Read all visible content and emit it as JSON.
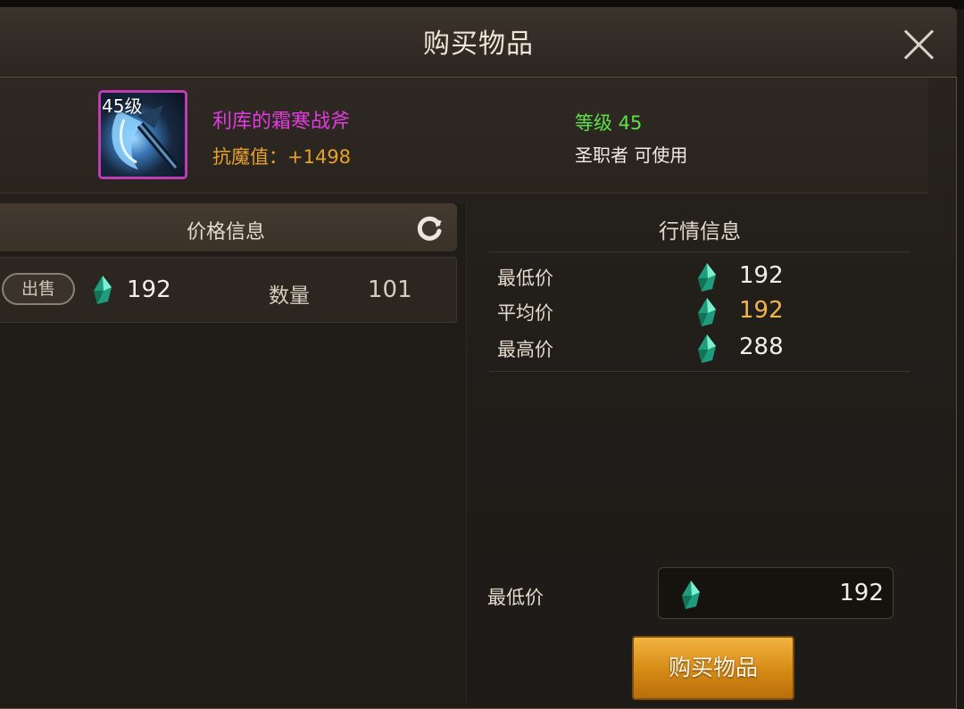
{
  "dialog": {
    "title": "购买物品"
  },
  "item": {
    "level_badge": "45级",
    "name": "利库的霜寒战斧",
    "stat": "抗魔值：+1498",
    "required_level": "等级 45",
    "usable_by": "圣职者 可使用"
  },
  "price_info": {
    "header": "价格信息",
    "listing": {
      "type": "出售",
      "price": "192",
      "quantity_label": "数量",
      "quantity": "101"
    }
  },
  "market_info": {
    "header": "行情信息",
    "rows": [
      {
        "label": "最低价",
        "value": "192"
      },
      {
        "label": "平均价",
        "value": "192"
      },
      {
        "label": "最高价",
        "value": "288"
      }
    ]
  },
  "purchase": {
    "price_label": "最低价",
    "price_value": "192",
    "buy_label": "购买物品"
  },
  "colors": {
    "item_name": "#e23ce0",
    "stat": "#e7a12a",
    "level_ok": "#5fe04a",
    "average_price": "#f0b64c",
    "button": "#e39a22"
  },
  "icons": [
    "close-icon",
    "refresh-icon",
    "gem-currency-icon",
    "axe-item-icon"
  ]
}
